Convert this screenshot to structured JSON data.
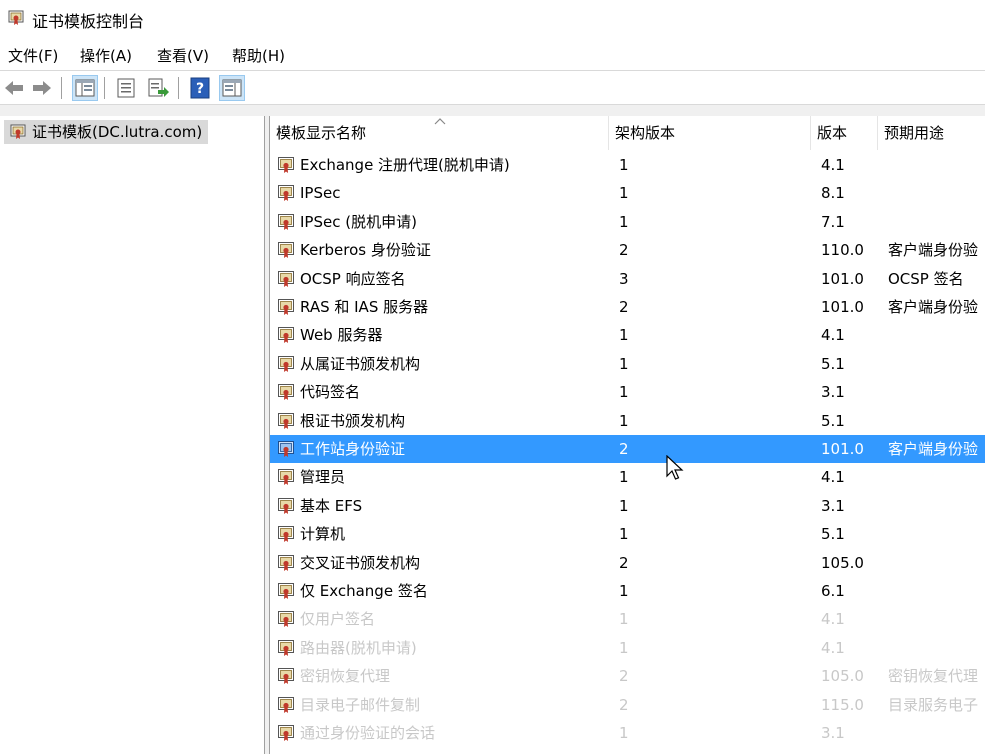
{
  "window": {
    "title": "证书模板控制台"
  },
  "menu": [
    {
      "label": "文件(F)"
    },
    {
      "label": "操作(A)"
    },
    {
      "label": "查看(V)"
    },
    {
      "label": "帮助(H)"
    }
  ],
  "toolbar": {
    "buttons": [
      "back-icon",
      "forward-icon",
      "show-hide-tree-icon",
      "properties-icon",
      "export-list-icon",
      "help-icon",
      "action-pane-icon"
    ]
  },
  "tree": {
    "root_label": "证书模板(DC.lutra.com)"
  },
  "list": {
    "columns": [
      "模板显示名称",
      "架构版本",
      "版本",
      "预期用途"
    ],
    "rows": [
      {
        "name": "Exchange 注册代理(脱机申请)",
        "schema": "1",
        "version": "4.1",
        "purpose": "",
        "state": "normal"
      },
      {
        "name": "IPSec",
        "schema": "1",
        "version": "8.1",
        "purpose": "",
        "state": "normal"
      },
      {
        "name": "IPSec (脱机申请)",
        "schema": "1",
        "version": "7.1",
        "purpose": "",
        "state": "normal"
      },
      {
        "name": "Kerberos 身份验证",
        "schema": "2",
        "version": "110.0",
        "purpose": "客户端身份验",
        "state": "normal"
      },
      {
        "name": "OCSP 响应签名",
        "schema": "3",
        "version": "101.0",
        "purpose": "OCSP 签名",
        "state": "normal"
      },
      {
        "name": "RAS 和 IAS 服务器",
        "schema": "2",
        "version": "101.0",
        "purpose": "客户端身份验",
        "state": "normal"
      },
      {
        "name": "Web 服务器",
        "schema": "1",
        "version": "4.1",
        "purpose": "",
        "state": "normal"
      },
      {
        "name": "从属证书颁发机构",
        "schema": "1",
        "version": "5.1",
        "purpose": "",
        "state": "normal"
      },
      {
        "name": "代码签名",
        "schema": "1",
        "version": "3.1",
        "purpose": "",
        "state": "normal"
      },
      {
        "name": "根证书颁发机构",
        "schema": "1",
        "version": "5.1",
        "purpose": "",
        "state": "normal"
      },
      {
        "name": "工作站身份验证",
        "schema": "2",
        "version": "101.0",
        "purpose": "客户端身份验",
        "state": "selected"
      },
      {
        "name": "管理员",
        "schema": "1",
        "version": "4.1",
        "purpose": "",
        "state": "normal"
      },
      {
        "name": "基本 EFS",
        "schema": "1",
        "version": "3.1",
        "purpose": "",
        "state": "normal"
      },
      {
        "name": "计算机",
        "schema": "1",
        "version": "5.1",
        "purpose": "",
        "state": "normal"
      },
      {
        "name": "交叉证书颁发机构",
        "schema": "2",
        "version": "105.0",
        "purpose": "",
        "state": "normal"
      },
      {
        "name": "仅 Exchange 签名",
        "schema": "1",
        "version": "6.1",
        "purpose": "",
        "state": "normal"
      },
      {
        "name": "仅用户签名",
        "schema": "1",
        "version": "4.1",
        "purpose": "",
        "state": "faded"
      },
      {
        "name": "路由器(脱机申请)",
        "schema": "1",
        "version": "4.1",
        "purpose": "",
        "state": "faded"
      },
      {
        "name": "密钥恢复代理",
        "schema": "2",
        "version": "105.0",
        "purpose": "密钥恢复代理",
        "state": "faded"
      },
      {
        "name": "目录电子邮件复制",
        "schema": "2",
        "version": "115.0",
        "purpose": "目录服务电子",
        "state": "faded"
      },
      {
        "name": "通过身份验证的会话",
        "schema": "1",
        "version": "3.1",
        "purpose": "",
        "state": "faded"
      }
    ]
  },
  "colors": {
    "selection": "#3399ff",
    "faded_text": "#c8c8c8"
  }
}
